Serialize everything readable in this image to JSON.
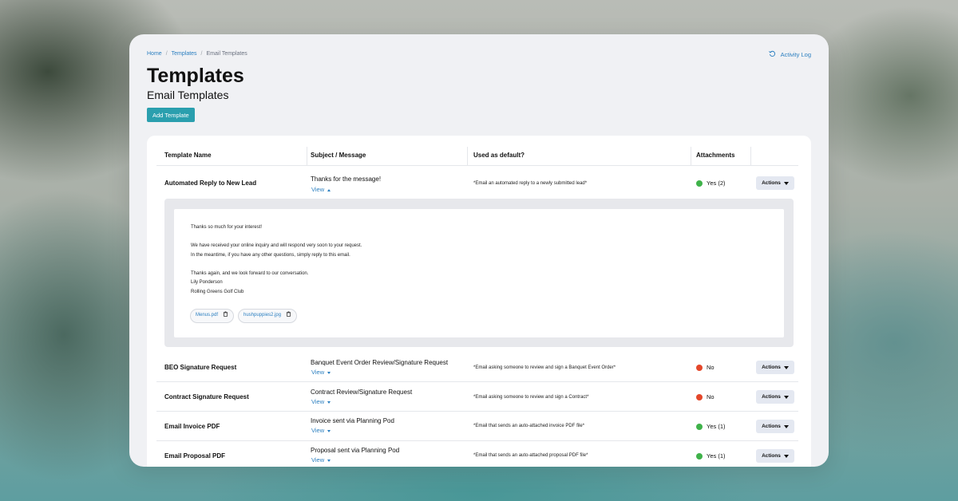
{
  "breadcrumb": {
    "home": "Home",
    "templates": "Templates",
    "current": "Email Templates",
    "sep": "/"
  },
  "activity_log": {
    "label": "Activity Log",
    "icon": "history-icon"
  },
  "page": {
    "title": "Templates",
    "subtitle": "Email Templates",
    "add_button": "Add Template"
  },
  "table": {
    "headers": {
      "name": "Template Name",
      "subject": "Subject / Message",
      "used": "Used as default?",
      "attachments": "Attachments"
    },
    "view_label": "View",
    "actions_label": "Actions",
    "rows": [
      {
        "name": "Automated Reply to New Lead",
        "subject": "Thanks for the message!",
        "used": "*Email an automated reply to a newly submitted lead*",
        "attachments": "Yes (2)",
        "status": "green",
        "expanded": true
      },
      {
        "name": "BEO Signature Request",
        "subject": "Banquet Event Order Review/Signature Request",
        "used": "*Email asking someone to review and sign a Banquet Event Order*",
        "attachments": "No",
        "status": "red"
      },
      {
        "name": "Contract Signature Request",
        "subject": "Contract Review/Signature Request",
        "used": "*Email asking someone to review and sign a Contract*",
        "attachments": "No",
        "status": "red"
      },
      {
        "name": "Email Invoice PDF",
        "subject": "Invoice sent via Planning Pod",
        "used": "*Email that sends an auto-attached invoice PDF file*",
        "attachments": "Yes (1)",
        "status": "green"
      },
      {
        "name": "Email Proposal PDF",
        "subject": "Proposal sent via Planning Pod",
        "used": "*Email that sends an auto-attached proposal PDF file*",
        "attachments": "Yes (1)",
        "status": "green"
      }
    ]
  },
  "preview": {
    "lines": [
      "Thanks so much for your interest!",
      "We have received your online inquiry and will respond very soon to your request.",
      "In the meantime, if you have any other questions, simply reply to this email.",
      "Thanks again, and we look forward to our conversation.",
      "Lily Ponderson",
      "Rolling Greens Golf Club"
    ],
    "attachments": [
      "Menus.pdf",
      "hushpuppies2.jpg"
    ]
  },
  "colors": {
    "accent": "#2a9fae",
    "link": "#2b7fc0",
    "green": "#3fb24a",
    "red": "#e4472a"
  }
}
